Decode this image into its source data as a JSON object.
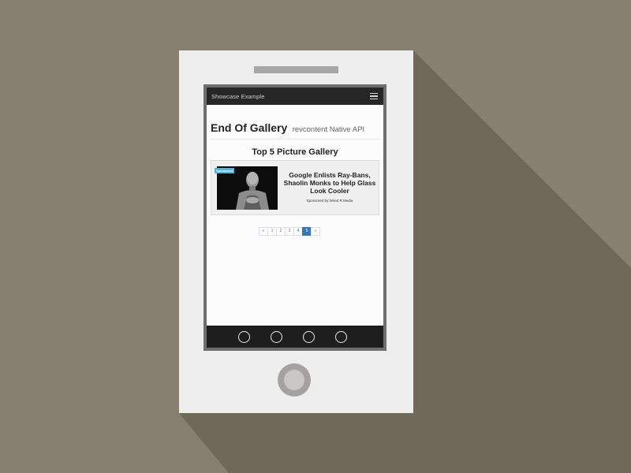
{
  "colors": {
    "background": "#85806f",
    "shadow": "#6e6959",
    "phone_body": "#eeeeef",
    "navbar": "#262626",
    "accent": "#337ab7",
    "badge": "#48b4e0"
  },
  "navbar": {
    "brand": "Showcase Example",
    "menu_icon": "hamburger-menu-icon"
  },
  "header": {
    "title": "End Of Gallery",
    "subtitle": "revcontent Native API"
  },
  "gallery": {
    "title": "Top 5 Picture Gallery"
  },
  "ad": {
    "badge": "Sponsored",
    "headline": "Google Enlists Ray-Bans, Shaolin Monks to Help Glass Look Cooler",
    "sponsor": "Sponsored by Wired R Media"
  },
  "pagination": {
    "prev": "«",
    "pages": [
      "1",
      "2",
      "3",
      "4",
      "5"
    ],
    "active_page": "5",
    "next": "»"
  },
  "bottom_bar": {
    "buttons": [
      "circle-button-icon",
      "circle-button-icon",
      "circle-button-icon",
      "circle-button-icon"
    ]
  }
}
